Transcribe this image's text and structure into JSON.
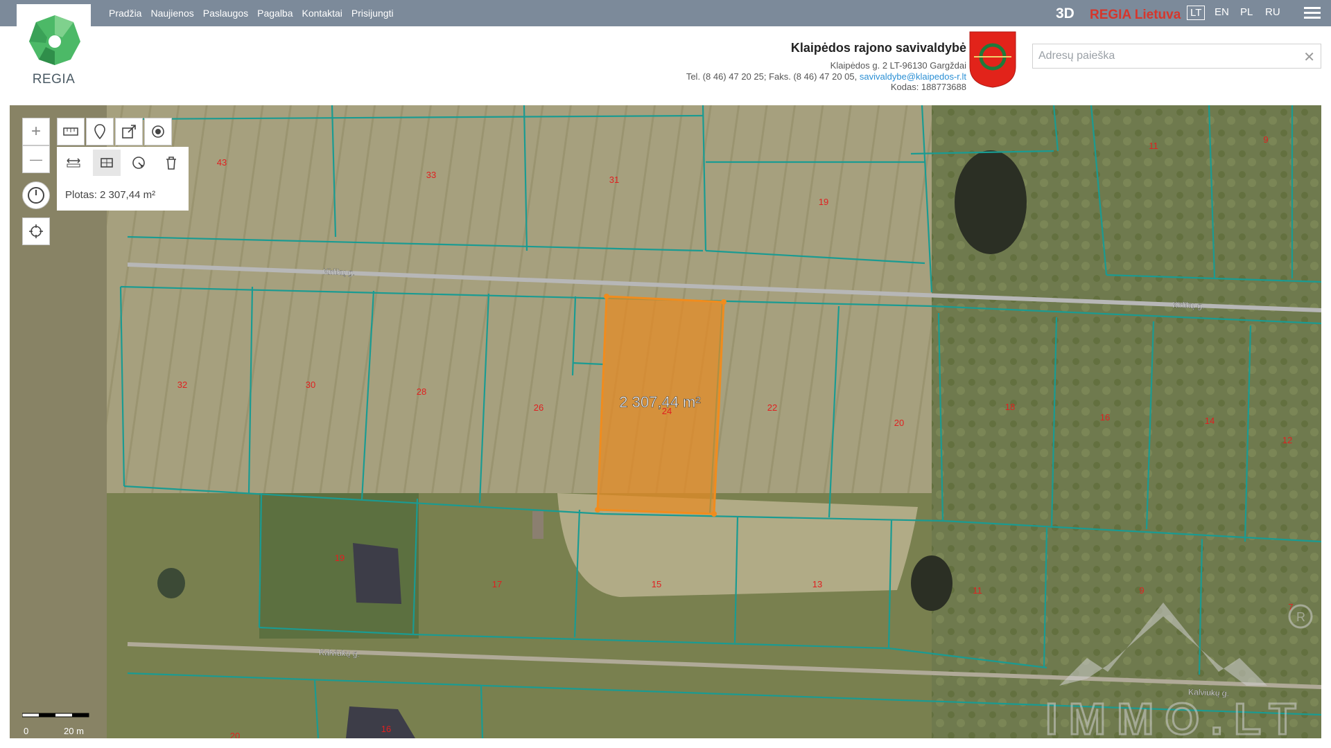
{
  "nav": {
    "items": [
      "Pradžia",
      "Naujienos",
      "Paslaugos",
      "Pagalba",
      "Kontaktai",
      "Prisijungti"
    ]
  },
  "brand": {
    "logo_text": "REGIA",
    "logo_color": "#47b665"
  },
  "topright": {
    "btn_3d": "3D",
    "regia_lietuva": "REGIA Lietuva",
    "languages": [
      "LT",
      "EN",
      "PL",
      "RU"
    ],
    "active_language": "LT"
  },
  "municipality": {
    "name": "Klaipėdos rajono savivaldybė",
    "address": "Klaipėdos g. 2 LT-96130 Gargždai",
    "phone": "Tel. (8 46) 47 20 25; Faks. (8 46) 47 20 05,",
    "email": "savivaldybe@klaipedos-r.lt",
    "code": "Kodas: 188773688"
  },
  "search": {
    "placeholder": "Adresų paieška",
    "clear_icon": "close-icon"
  },
  "map": {
    "measurement_label": "2 307,44 m²",
    "tool_panel_area": "Plotas: 2 307,44 m²",
    "scale": {
      "start": "0",
      "end": "20 m"
    },
    "streets": [
      "Kirlikų g.",
      "Kirlikų g.",
      "Kalviukų g.",
      "Kalviukų g."
    ],
    "parcel_numbers": [
      "43",
      "33",
      "31",
      "19",
      "11",
      "9",
      "32",
      "30",
      "28",
      "26",
      "24",
      "22",
      "20",
      "18",
      "16",
      "14",
      "12",
      "19",
      "17",
      "15",
      "13",
      "11",
      "9",
      "7",
      "16",
      "20"
    ],
    "watermark": "IMMO.LT",
    "colors": {
      "parcel_line": "#1a9b92",
      "selection": "#f08c1e",
      "parcel_number": "#e02020"
    }
  },
  "toolbar": {
    "zoom_in": "+",
    "zoom_out": "—",
    "top_tools": [
      "ruler-icon",
      "pin-icon",
      "share-icon",
      "target-icon"
    ],
    "sub_tools": [
      "measure-line-icon",
      "measure-area-icon",
      "measure-radius-icon",
      "trash-icon"
    ]
  }
}
